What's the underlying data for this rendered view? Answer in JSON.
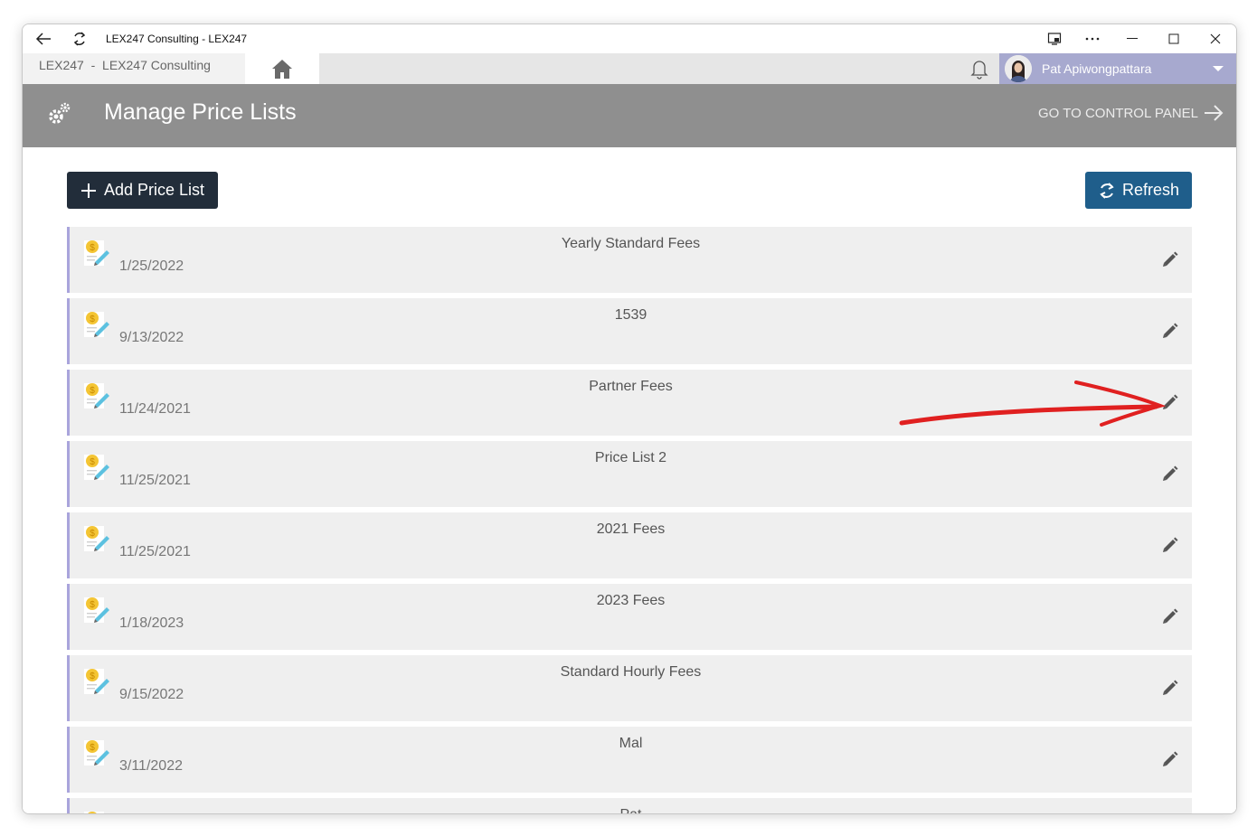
{
  "window": {
    "title": "LEX247 Consulting - LEX247"
  },
  "tabbar": {
    "main_tab": "LEX247  -  LEX247 Consulting",
    "user_name": "Pat Apiwongpattara"
  },
  "header": {
    "title": "Manage Price Lists",
    "control_panel_link": "GO TO CONTROL PANEL"
  },
  "toolbar": {
    "add_label": "Add Price List",
    "refresh_label": "Refresh"
  },
  "price_lists": [
    {
      "name": "Yearly Standard Fees",
      "date": "1/25/2022"
    },
    {
      "name": "1539",
      "date": "9/13/2022"
    },
    {
      "name": "Partner Fees",
      "date": "11/24/2021"
    },
    {
      "name": "Price List 2",
      "date": "11/25/2021"
    },
    {
      "name": "2021 Fees",
      "date": "11/25/2021"
    },
    {
      "name": "2023 Fees",
      "date": "1/18/2023"
    },
    {
      "name": "Standard Hourly Fees",
      "date": "9/15/2022"
    },
    {
      "name": "Mal",
      "date": "3/11/2022"
    },
    {
      "name": "Pat",
      "date": ""
    }
  ],
  "icons": {
    "back": "arrow-left-icon",
    "reload": "refresh-icon",
    "home": "home-icon",
    "bell": "bell-icon",
    "gear": "gears-icon",
    "edit": "pencil-icon",
    "price_list": "price-list-document-icon"
  },
  "colors": {
    "header_bg": "#8f8f8f",
    "user_area_bg": "#a7a9cf",
    "add_button_bg": "#222d3a",
    "refresh_button_bg": "#1f5e8b",
    "row_bg": "#efefef",
    "row_accent": "#a9a4dc",
    "annotation_arrow": "#e02020"
  }
}
